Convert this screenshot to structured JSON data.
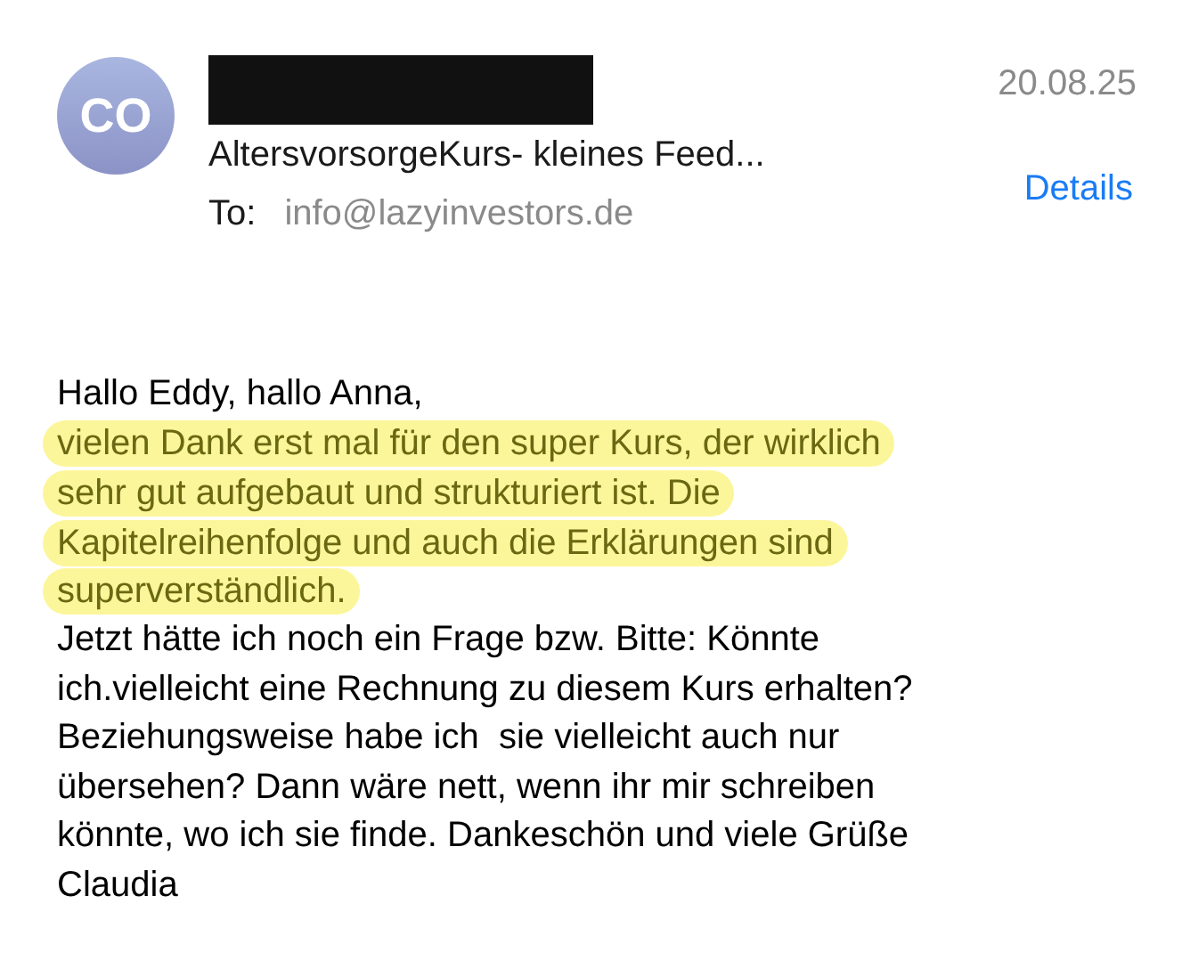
{
  "header": {
    "avatar_initials": "CO",
    "sender_redacted": true,
    "subject": "AltersvorsorgeKurs- kleines Feed...",
    "to_label": "To:",
    "to_address": "info@lazyinvestors.de",
    "date": "20.08.25",
    "details_link": "Details"
  },
  "body": [
    {
      "text": "Hallo Eddy, hallo Anna,",
      "highlighted": false
    },
    {
      "text": "vielen Dank erst mal für den super Kurs, der wirklich",
      "highlighted": true
    },
    {
      "text": "sehr gut aufgebaut und strukturiert ist. Die",
      "highlighted": true
    },
    {
      "text": "Kapitelreihenfolge und auch die Erklärungen sind",
      "highlighted": true
    },
    {
      "text": "superverständlich.",
      "highlighted": true
    },
    {
      "text": "Jetzt hätte ich noch ein Frage bzw. Bitte: Könnte",
      "highlighted": false
    },
    {
      "text": "ich.vielleicht eine Rechnung zu diesem Kurs erhalten?",
      "highlighted": false
    },
    {
      "text": "Beziehungsweise habe ich  sie vielleicht auch nur",
      "highlighted": false
    },
    {
      "text": "übersehen? Dann wäre nett, wenn ihr mir schreiben",
      "highlighted": false
    },
    {
      "text": "könnte, wo ich sie finde. Dankeschön und viele Grüße",
      "highlighted": false
    },
    {
      "text": "Claudia",
      "highlighted": false
    }
  ]
}
